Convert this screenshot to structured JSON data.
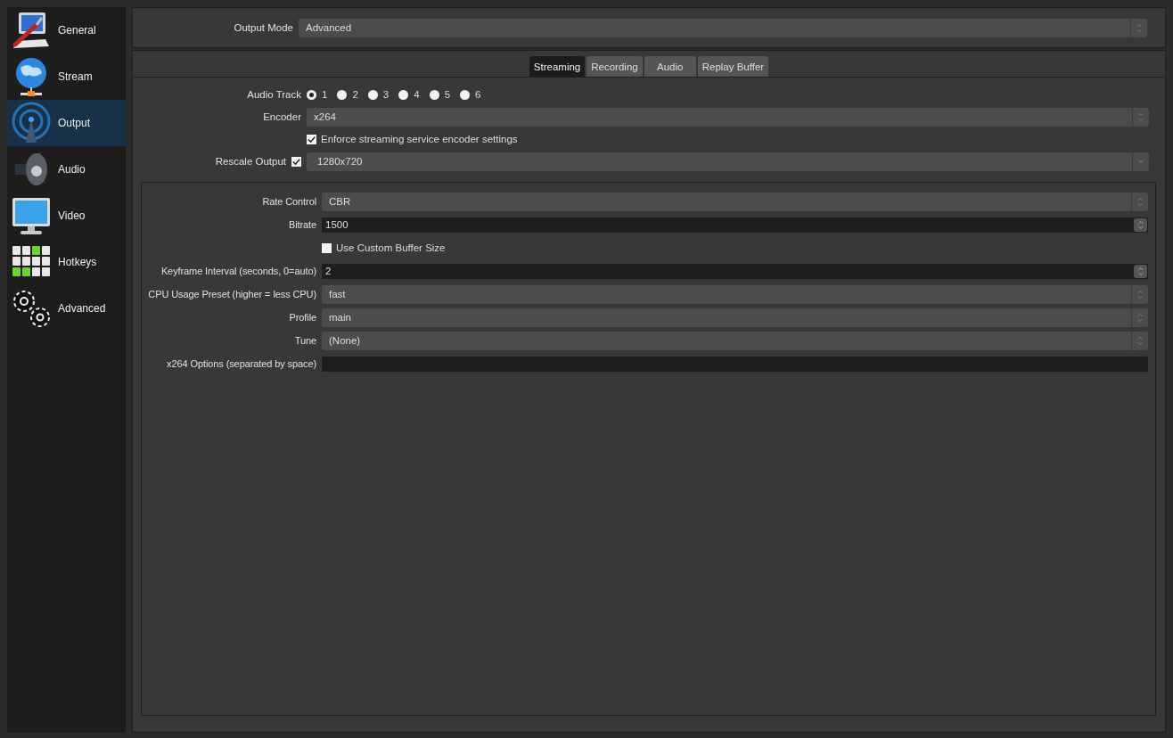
{
  "sidebar": {
    "items": [
      {
        "label": "General",
        "selected": false
      },
      {
        "label": "Stream",
        "selected": false
      },
      {
        "label": "Output",
        "selected": true
      },
      {
        "label": "Audio",
        "selected": false
      },
      {
        "label": "Video",
        "selected": false
      },
      {
        "label": "Hotkeys",
        "selected": false
      },
      {
        "label": "Advanced",
        "selected": false
      }
    ]
  },
  "output_mode": {
    "label": "Output Mode",
    "value": "Advanced"
  },
  "tabs": [
    {
      "label": "Streaming",
      "selected": true
    },
    {
      "label": "Recording",
      "selected": false
    },
    {
      "label": "Audio",
      "selected": false
    },
    {
      "label": "Replay Buffer",
      "selected": false
    }
  ],
  "streaming": {
    "audio_track": {
      "label": "Audio Track",
      "options": [
        {
          "label": "1",
          "selected": true
        },
        {
          "label": "2",
          "selected": false
        },
        {
          "label": "3",
          "selected": false
        },
        {
          "label": "4",
          "selected": false
        },
        {
          "label": "5",
          "selected": false
        },
        {
          "label": "6",
          "selected": false
        }
      ]
    },
    "rows": [
      {
        "kind": "combo",
        "label": "Encoder",
        "value": "x264"
      },
      {
        "kind": "checkbox",
        "label": "Enforce streaming service encoder settings",
        "checked": true
      },
      {
        "kind": "check-dropdown",
        "label": "Rescale Output",
        "checked": true,
        "value": "1280x720"
      }
    ]
  },
  "encoder_settings": {
    "rows": [
      {
        "kind": "combo",
        "label": "Rate Control",
        "value": "CBR"
      },
      {
        "kind": "spin",
        "label": "Bitrate",
        "value": "1500"
      },
      {
        "kind": "checkbox",
        "label": "Use Custom Buffer Size",
        "checked": false
      },
      {
        "kind": "spin",
        "label": "Keyframe Interval (seconds, 0=auto)",
        "value": "2"
      },
      {
        "kind": "combo",
        "label": "CPU Usage Preset (higher = less CPU)",
        "value": "fast"
      },
      {
        "kind": "combo",
        "label": "Profile",
        "value": "main"
      },
      {
        "kind": "combo",
        "label": "Tune",
        "value": "(None)"
      },
      {
        "kind": "text",
        "label": "x264 Options (separated by space)",
        "value": ""
      }
    ]
  }
}
